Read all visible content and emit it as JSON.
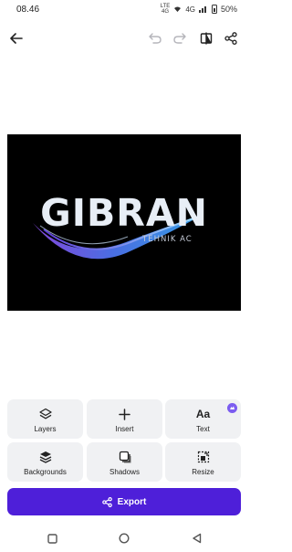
{
  "status_bar": {
    "time": "08.46",
    "network_small_top": "LTE",
    "network_small_bottom": "4G",
    "signal_text": "4G",
    "battery": "50%"
  },
  "toolbar": {
    "back_icon": "arrow-left-icon",
    "undo_icon": "undo-icon",
    "redo_icon": "redo-icon",
    "compare_icon": "compare-icon",
    "share_icon": "share-icon"
  },
  "canvas": {
    "logo_title": "GIBRAN",
    "logo_subtitle": "TEHNIK AC",
    "colors": {
      "background": "#000000",
      "wave_blue": "#3aa0f0",
      "wave_purple": "#8a4be6"
    }
  },
  "tools": [
    {
      "label": "Layers",
      "icon": "layers-icon"
    },
    {
      "label": "Insert",
      "icon": "plus-icon"
    },
    {
      "label": "Text",
      "icon": "text-aa-icon",
      "badge": "pro-badge-icon"
    },
    {
      "label": "Backgrounds",
      "icon": "backgrounds-icon"
    },
    {
      "label": "Shadows",
      "icon": "shadows-icon"
    },
    {
      "label": "Resize",
      "icon": "resize-icon"
    }
  ],
  "export": {
    "label": "Export",
    "icon": "share-icon",
    "color": "#4e1fd9"
  },
  "navbar": {
    "items": [
      "recents-icon",
      "home-icon",
      "back-triangle-icon"
    ]
  }
}
